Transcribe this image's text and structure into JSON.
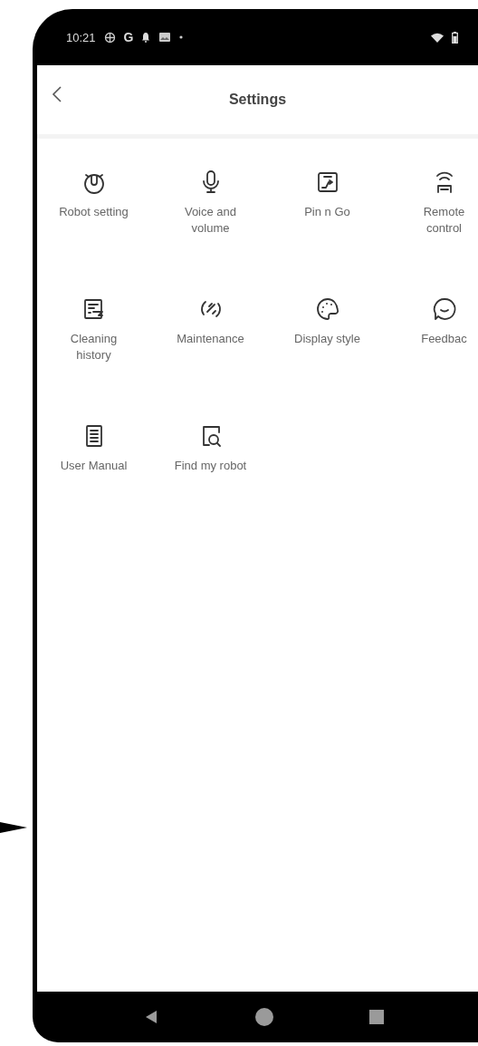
{
  "status_bar": {
    "time": "10:21",
    "app_letter": "G"
  },
  "header": {
    "title": "Settings"
  },
  "tiles": [
    {
      "label": "Robot setting"
    },
    {
      "label": "Voice and\nvolume"
    },
    {
      "label": "Pin n Go"
    },
    {
      "label": "Remote\ncontrol"
    },
    {
      "label": "Cleaning\nhistory"
    },
    {
      "label": "Maintenance"
    },
    {
      "label": "Display style"
    },
    {
      "label": "Feedbac"
    },
    {
      "label": "User Manual"
    },
    {
      "label": "Find my robot"
    }
  ]
}
